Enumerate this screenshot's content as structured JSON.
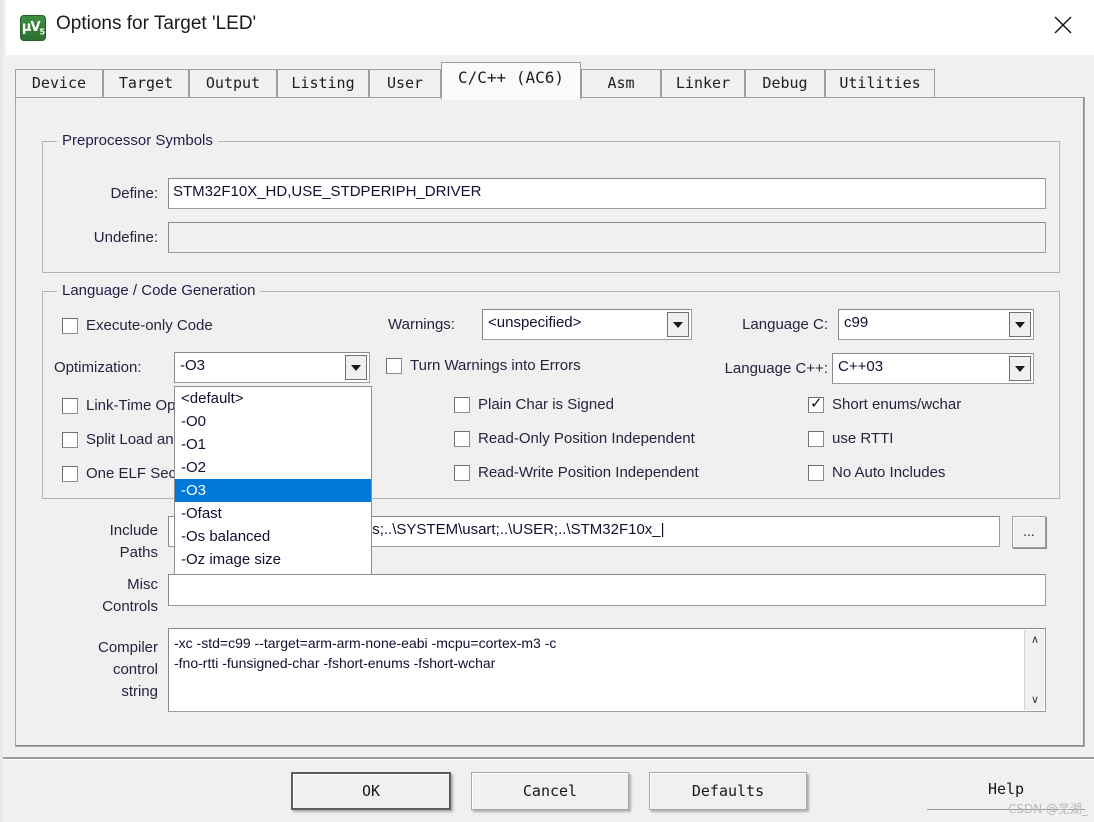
{
  "window": {
    "title": "Options for Target 'LED'",
    "icon": "uvision-icon",
    "close_label": "✕"
  },
  "tabs": [
    {
      "label": "Device",
      "active": false,
      "left": 0,
      "width": 88
    },
    {
      "label": "Target",
      "active": false,
      "width": 86
    },
    {
      "label": "Output",
      "active": false,
      "width": 88
    },
    {
      "label": "Listing",
      "active": false,
      "width": 92
    },
    {
      "label": "User",
      "active": false,
      "width": 72
    },
    {
      "label": "C/C++ (AC6)",
      "active": true,
      "width": 140
    },
    {
      "label": "Asm",
      "active": false,
      "width": 80
    },
    {
      "label": "Linker",
      "active": false,
      "width": 84
    },
    {
      "label": "Debug",
      "active": false,
      "width": 80
    },
    {
      "label": "Utilities",
      "active": false,
      "width": 110
    }
  ],
  "preprocessor": {
    "legend": "Preprocessor Symbols",
    "define_label": "Define:",
    "define_value": "STM32F10X_HD,USE_STDPERIPH_DRIVER",
    "undefine_label": "Undefine:",
    "undefine_value": ""
  },
  "language": {
    "legend": "Language / Code Generation",
    "execute_only_code": {
      "label": "Execute-only Code",
      "checked": false
    },
    "optimization_label": "Optimization:",
    "optimization_value": "-O3",
    "optimization_options": [
      "<default>",
      "-O0",
      "-O1",
      "-O2",
      "-O3",
      "-Ofast",
      "-Os balanced",
      "-Oz image size"
    ],
    "optimization_selected_index": 4,
    "link_time_opt": {
      "label": "Link-Time Optimization",
      "checked": false
    },
    "split_load": {
      "label": "Split Load and Store Multiple",
      "checked": false
    },
    "one_elf": {
      "label": "One ELF Section per Function",
      "checked": false
    },
    "warnings_label": "Warnings:",
    "warnings_value": "<unspecified>",
    "turn_warnings_into_errors": {
      "label": "Turn Warnings into Errors",
      "checked": false
    },
    "plain_char_is_signed": {
      "label": "Plain Char is Signed",
      "checked": false
    },
    "read_only_position_independent": {
      "label": "Read-Only Position Independent",
      "checked": false
    },
    "read_write_position_independent": {
      "label": "Read-Write Position Independent",
      "checked": false
    },
    "language_c_label": "Language C:",
    "language_c_value": "c99",
    "language_cpp_label": "Language C++:",
    "language_cpp_value": "C++03",
    "short_enums_wchar": {
      "label": "Short enums/wchar",
      "checked": true
    },
    "use_rtti": {
      "label": "use RTTI",
      "checked": false
    },
    "no_auto_includes": {
      "label": "No Auto Includes",
      "checked": false
    }
  },
  "paths": {
    "include_label_line1": "Include",
    "include_label_line2": "Paths",
    "include_value": "..\\SYSTEM\\delay;..\\SYSTEM\\sys;..\\SYSTEM\\usart;..\\USER;..\\STM32F10x_I",
    "include_value_visible": "SYSTEM\\delay;..\\SYSTEM\\sys;..\\SYSTEM\\usart;..\\USER;..\\STM32F10x_|",
    "include_prefix": "..",
    "browse_label": "...",
    "misc_label_line1": "Misc",
    "misc_label_line2": "Controls",
    "misc_value": ""
  },
  "compiler_control": {
    "label_line1": "Compiler",
    "label_line2": "control",
    "label_line3": "string",
    "lines": [
      "-xc -std=c99 --target=arm-arm-none-eabi -mcpu=cortex-m3 -c",
      "-fno-rtti -funsigned-char -fshort-enums -fshort-wchar"
    ],
    "scroll_up": "∧",
    "scroll_down": "∨"
  },
  "buttons": {
    "ok": "OK",
    "cancel": "Cancel",
    "defaults": "Defaults",
    "help": "Help"
  },
  "watermark": "CSDN @芜湖_",
  "colors": {
    "dialog_bg": "#f0f0f0",
    "titlebar_bg": "#ffffff",
    "selection_blue": "#0078d7",
    "label_text": "#24243f",
    "group_border": "#b4b4b4",
    "icon_green": "#3f8e43"
  }
}
